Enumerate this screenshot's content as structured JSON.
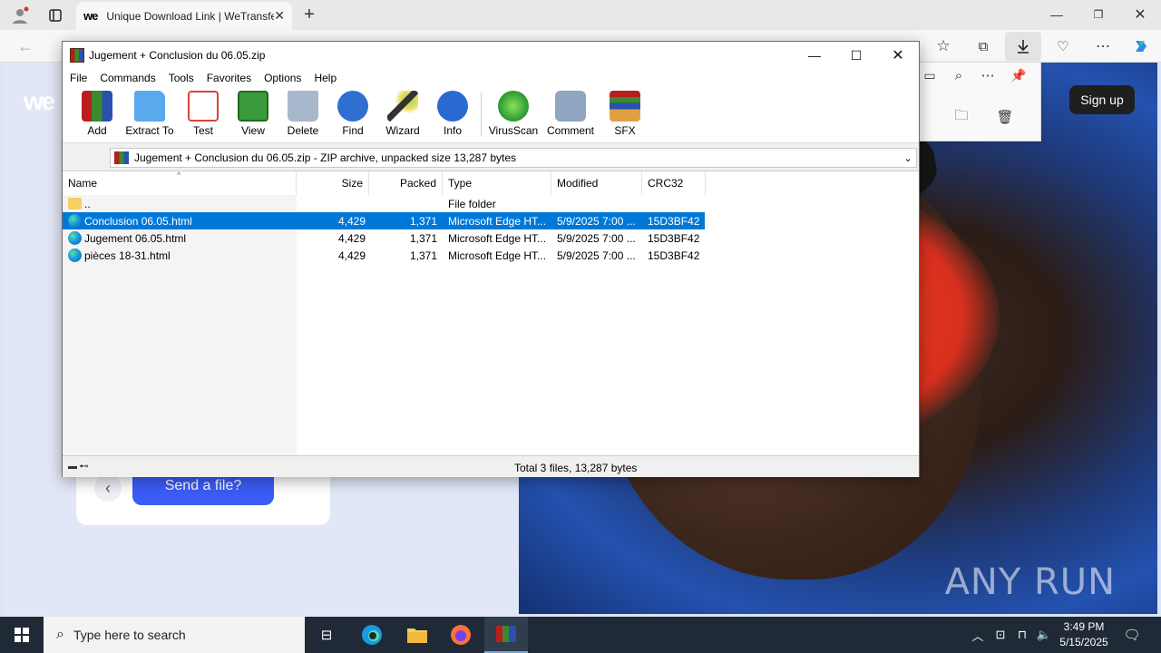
{
  "browser": {
    "tab_title": "Unique Download Link | WeTransfer",
    "tab_favicon": "we",
    "page": {
      "logo": "we",
      "signup_label": "Sign up",
      "send_label": "Send a file?",
      "watermark": "ANY RUN"
    }
  },
  "winrar": {
    "title": "Jugement + Conclusion du 06.05.zip",
    "menu": [
      "File",
      "Commands",
      "Tools",
      "Favorites",
      "Options",
      "Help"
    ],
    "toolbar": [
      {
        "label": "Add",
        "icon": "add-icon",
        "color": "#c0392b"
      },
      {
        "label": "Extract To",
        "icon": "extract-folder-icon",
        "color": "#3d8fe0"
      },
      {
        "label": "Test",
        "icon": "test-icon",
        "color": "#d9443a"
      },
      {
        "label": "View",
        "icon": "book-icon",
        "color": "#3b9a3b"
      },
      {
        "label": "Delete",
        "icon": "trash-icon",
        "color": "#8aa0b8"
      },
      {
        "label": "Find",
        "icon": "magnifier-icon",
        "color": "#2f6fd0"
      },
      {
        "label": "Wizard",
        "icon": "wand-icon",
        "color": "#9bd06a"
      },
      {
        "label": "Info",
        "icon": "info-icon",
        "color": "#2a6ad0"
      },
      {
        "label": "VirusScan",
        "icon": "virus-icon",
        "color": "#3aa83a"
      },
      {
        "label": "Comment",
        "icon": "comment-icon",
        "color": "#7f95b0"
      },
      {
        "label": "SFX",
        "icon": "sfx-box-icon",
        "color": "#e0a040"
      }
    ],
    "path": "Jugement + Conclusion du 06.05.zip - ZIP archive, unpacked size 13,287 bytes",
    "columns": [
      "Name",
      "Size",
      "Packed",
      "Type",
      "Modified",
      "CRC32"
    ],
    "rows": [
      {
        "name": "..",
        "size": "",
        "packed": "",
        "type": "File folder",
        "modified": "",
        "crc": "",
        "selected": false,
        "folder": true
      },
      {
        "name": "Conclusion 06.05.html",
        "size": "4,429",
        "packed": "1,371",
        "type": "Microsoft Edge HT...",
        "modified": "5/9/2025 7:00 ...",
        "crc": "15D3BF42",
        "selected": true,
        "folder": false
      },
      {
        "name": "Jugement 06.05.html",
        "size": "4,429",
        "packed": "1,371",
        "type": "Microsoft Edge HT...",
        "modified": "5/9/2025 7:00 ...",
        "crc": "15D3BF42",
        "selected": false,
        "folder": false
      },
      {
        "name": "pièces 18-31.html",
        "size": "4,429",
        "packed": "1,371",
        "type": "Microsoft Edge HT...",
        "modified": "5/9/2025 7:00 ...",
        "crc": "15D3BF42",
        "selected": false,
        "folder": false
      }
    ],
    "status": "Total 3 files, 13,287 bytes"
  },
  "taskbar": {
    "search_placeholder": "Type here to search",
    "time": "3:49 PM",
    "date": "5/15/2025"
  }
}
